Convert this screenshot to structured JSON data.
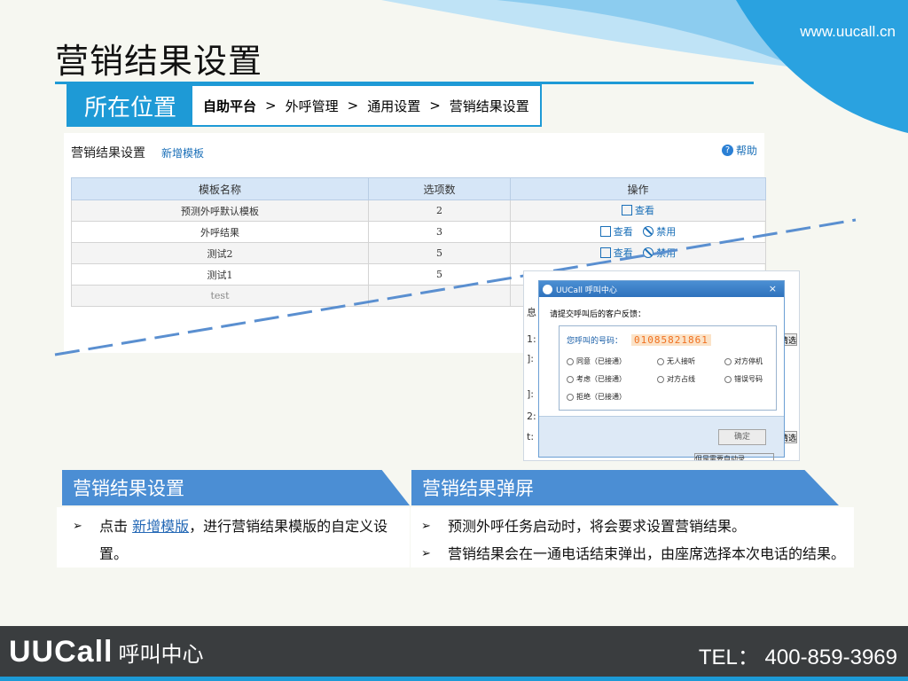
{
  "site_url": "www.uucall.cn",
  "page_title": "营销结果设置",
  "location": {
    "tag": "所在位置",
    "crumbs": [
      "自助平台",
      "外呼管理",
      "通用设置",
      "营销结果设置"
    ],
    "separator": ">"
  },
  "panel": {
    "title": "营销结果设置",
    "add_link": "新增模板",
    "help": "帮助",
    "columns": [
      "模板名称",
      "选项数",
      "操作"
    ],
    "rows": [
      {
        "name": "预测外呼默认模板",
        "count": "2",
        "ops": [
          "查看"
        ]
      },
      {
        "name": "外呼结果",
        "count": "3",
        "ops": [
          "查看",
          "禁用"
        ]
      },
      {
        "name": "测试2",
        "count": "5",
        "ops": [
          "查看",
          "禁用"
        ]
      },
      {
        "name": "测试1",
        "count": "5",
        "ops": []
      },
      {
        "name": "test",
        "count": "",
        "ops": []
      }
    ]
  },
  "dialog": {
    "title": "UUCall 呼叫中心",
    "close": "×",
    "question": "请提交呼叫后的客户反馈：",
    "number_label": "您呼叫的号码：",
    "number_value": "01085821861",
    "options": [
      "同意（已接通）",
      "无人接听",
      "对方停机",
      "考虑（已接通）",
      "对方占线",
      "错误号码",
      "拒绝（已接通）"
    ],
    "ok": "确定",
    "left_chars": [
      "息",
      "1:",
      "]:",
      "]:",
      "2:",
      "t:"
    ],
    "right_label": "请选",
    "bottom_cut": "但是需要自动录"
  },
  "section_left": {
    "heading": "营销结果设置",
    "bullet_prefix": "点击",
    "bullet_link": "新增模版",
    "bullet_suffix": "，进行营销结果模版的自定义设置。"
  },
  "section_right": {
    "heading": "营销结果弹屏",
    "bullets": [
      "预测外呼任务启动时，将会要求设置营销结果。",
      "营销结果会在一通电话结束弹出，由座席选择本次电话的结果。"
    ]
  },
  "footer": {
    "brand": "UUCall",
    "brand_sub": "呼叫中心",
    "tel": "TEL：  400-859-3969"
  },
  "colors": {
    "accent": "#1e9ad6",
    "band": "#4b8ed4",
    "footer": "#3a3d3f",
    "link": "#1a6fb8"
  }
}
